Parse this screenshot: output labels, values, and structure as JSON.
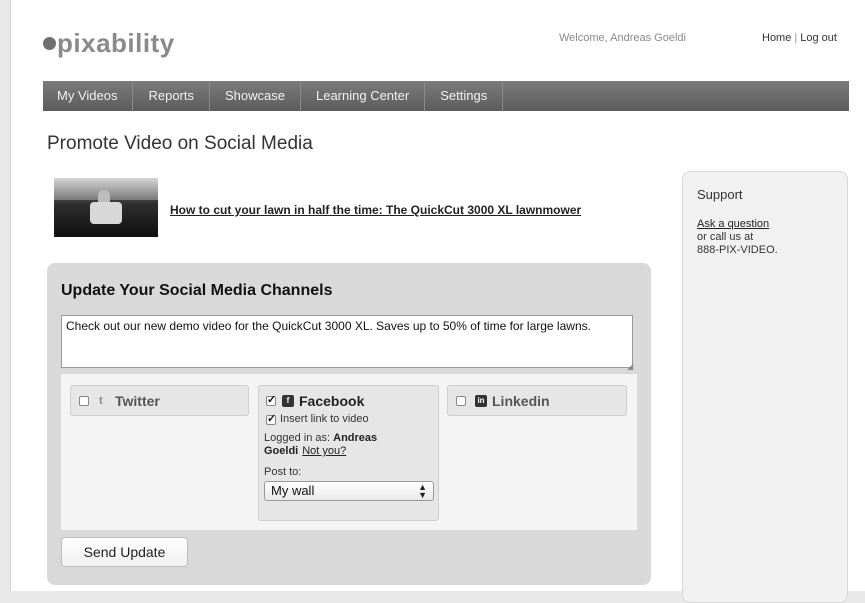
{
  "header": {
    "logo_text": "pixability",
    "welcome": "Welcome, Andreas Goeldi",
    "home_link": "Home",
    "separator": "|",
    "logout_link": "Log out"
  },
  "nav": {
    "items": [
      "My Videos",
      "Reports",
      "Showcase",
      "Learning Center",
      "Settings"
    ]
  },
  "page_title": "Promote Video on Social Media",
  "video": {
    "title_link": "How to cut your lawn in half the time: The QuickCut 3000 XL lawnmower"
  },
  "panel": {
    "title": "Update Your Social Media Channels",
    "message": "Check out our new demo video for the QuickCut 3000 XL. Saves up to 50% of time for large lawns.",
    "send_label": "Send Update"
  },
  "channels": {
    "twitter": {
      "label": "Twitter",
      "checked": false,
      "icon": "twitter-icon"
    },
    "facebook": {
      "label": "Facebook",
      "checked": true,
      "icon": "facebook-icon",
      "insert_link_label": "Insert link to video",
      "insert_link_checked": true,
      "logged_in_prefix": "Logged in as:",
      "logged_in_user": "Andreas Goeldi",
      "not_you_link": "Not you?",
      "post_to_label": "Post to:",
      "post_to_selected": "My wall"
    },
    "linkedin": {
      "label": "Linkedin",
      "checked": false,
      "icon": "linkedin-icon"
    }
  },
  "support": {
    "title": "Support",
    "ask_link": "Ask a question",
    "call_line": "or call us at",
    "phone": "888-PIX-VIDEO."
  }
}
